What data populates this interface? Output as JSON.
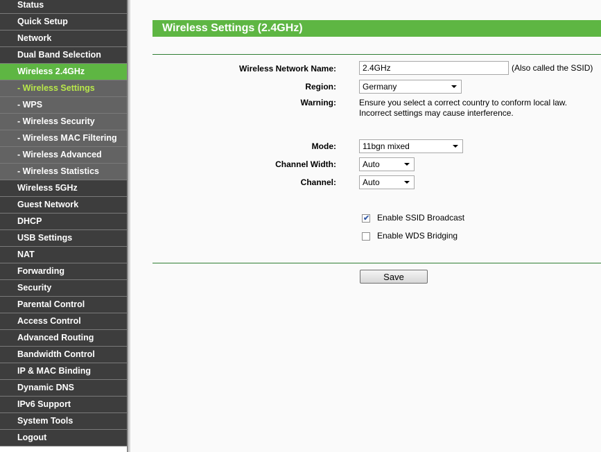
{
  "sidebar": {
    "items": [
      {
        "label": "Status",
        "type": "main",
        "state": ""
      },
      {
        "label": "Quick Setup",
        "type": "main",
        "state": ""
      },
      {
        "label": "Network",
        "type": "main",
        "state": ""
      },
      {
        "label": "Dual Band Selection",
        "type": "main",
        "state": ""
      },
      {
        "label": "Wireless 2.4GHz",
        "type": "main",
        "state": "active"
      },
      {
        "label": "- Wireless Settings",
        "type": "sub",
        "state": "current"
      },
      {
        "label": "- WPS",
        "type": "sub",
        "state": ""
      },
      {
        "label": "- Wireless Security",
        "type": "sub",
        "state": ""
      },
      {
        "label": "- Wireless MAC Filtering",
        "type": "sub",
        "state": ""
      },
      {
        "label": "- Wireless Advanced",
        "type": "sub",
        "state": ""
      },
      {
        "label": "- Wireless Statistics",
        "type": "sub",
        "state": ""
      },
      {
        "label": "Wireless 5GHz",
        "type": "main",
        "state": ""
      },
      {
        "label": "Guest Network",
        "type": "main",
        "state": ""
      },
      {
        "label": "DHCP",
        "type": "main",
        "state": ""
      },
      {
        "label": "USB Settings",
        "type": "main",
        "state": ""
      },
      {
        "label": "NAT",
        "type": "main",
        "state": ""
      },
      {
        "label": "Forwarding",
        "type": "main",
        "state": ""
      },
      {
        "label": "Security",
        "type": "main",
        "state": ""
      },
      {
        "label": "Parental Control",
        "type": "main",
        "state": ""
      },
      {
        "label": "Access Control",
        "type": "main",
        "state": ""
      },
      {
        "label": "Advanced Routing",
        "type": "main",
        "state": ""
      },
      {
        "label": "Bandwidth Control",
        "type": "main",
        "state": ""
      },
      {
        "label": "IP & MAC Binding",
        "type": "main",
        "state": ""
      },
      {
        "label": "Dynamic DNS",
        "type": "main",
        "state": ""
      },
      {
        "label": "IPv6 Support",
        "type": "main",
        "state": ""
      },
      {
        "label": "System Tools",
        "type": "main",
        "state": ""
      },
      {
        "label": "Logout",
        "type": "main",
        "state": ""
      }
    ]
  },
  "page": {
    "title": "Wireless Settings (2.4GHz)"
  },
  "form": {
    "ssid_label": "Wireless Network Name:",
    "ssid_value": "2.4GHz",
    "ssid_note": "(Also called the SSID)",
    "region_label": "Region:",
    "region_value": "Germany",
    "warning_label": "Warning:",
    "warning_line1": "Ensure you select a correct country to conform local law.",
    "warning_line2": "Incorrect settings may cause interference.",
    "mode_label": "Mode:",
    "mode_value": "11bgn mixed",
    "width_label": "Channel Width:",
    "width_value": "Auto",
    "channel_label": "Channel:",
    "channel_value": "Auto",
    "ssid_broadcast_label": "Enable SSID Broadcast",
    "ssid_broadcast_checked": true,
    "wds_label": "Enable WDS Bridging",
    "wds_checked": false,
    "save_label": "Save"
  },
  "colors": {
    "accent_green": "#5eb643",
    "sidebar_dark": "#3d3d3d",
    "sidebar_sub": "#636363",
    "current_sub_text": "#b8e84a"
  }
}
